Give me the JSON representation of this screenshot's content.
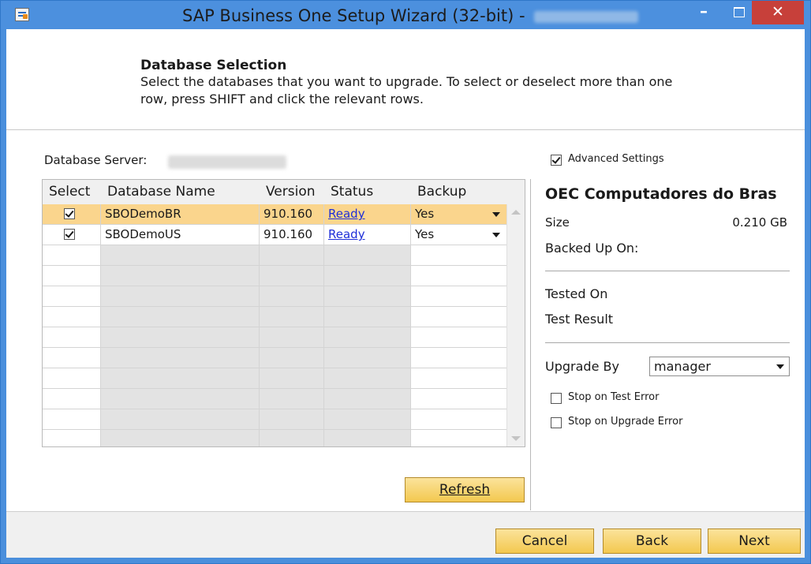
{
  "window": {
    "title": "SAP Business One Setup Wizard (32-bit) -",
    "minimize": "–",
    "close": "✕"
  },
  "header": {
    "title": "Database Selection",
    "description": "Select the databases that you want to upgrade. To select or deselect more than one row, press SHIFT and click the relevant rows."
  },
  "server": {
    "label": "Database Server:"
  },
  "grid": {
    "columns": [
      "Select",
      "Database Name",
      "Version",
      "Status",
      "Backup"
    ],
    "rows": [
      {
        "selected": true,
        "name": "SBODemoBR",
        "version": "910.160",
        "status": "Ready",
        "backup": "Yes"
      },
      {
        "selected": true,
        "name": "SBODemoUS",
        "version": "910.160",
        "status": "Ready",
        "backup": "Yes"
      }
    ]
  },
  "buttons": {
    "refresh": "Refresh",
    "cancel": "Cancel",
    "back": "Back",
    "next": "Next"
  },
  "details": {
    "advanced_settings": "Advanced Settings",
    "advanced_checked": true,
    "company": "OEC Computadores do Bras",
    "size_label": "Size",
    "size_value": "0.210 GB",
    "backed_up_label": "Backed Up On:",
    "tested_on_label": "Tested On",
    "test_result_label": "Test Result",
    "upgrade_by_label": "Upgrade By",
    "upgrade_by_value": "manager",
    "stop_test_error": "Stop on Test Error",
    "stop_upgrade_error": "Stop on Upgrade Error"
  },
  "colors": {
    "title_bar": "#4c90de",
    "close_button": "#c7403a",
    "selected_row": "#fad58d",
    "button_gold": "#f3c84f",
    "link": "#1f2fd8"
  }
}
